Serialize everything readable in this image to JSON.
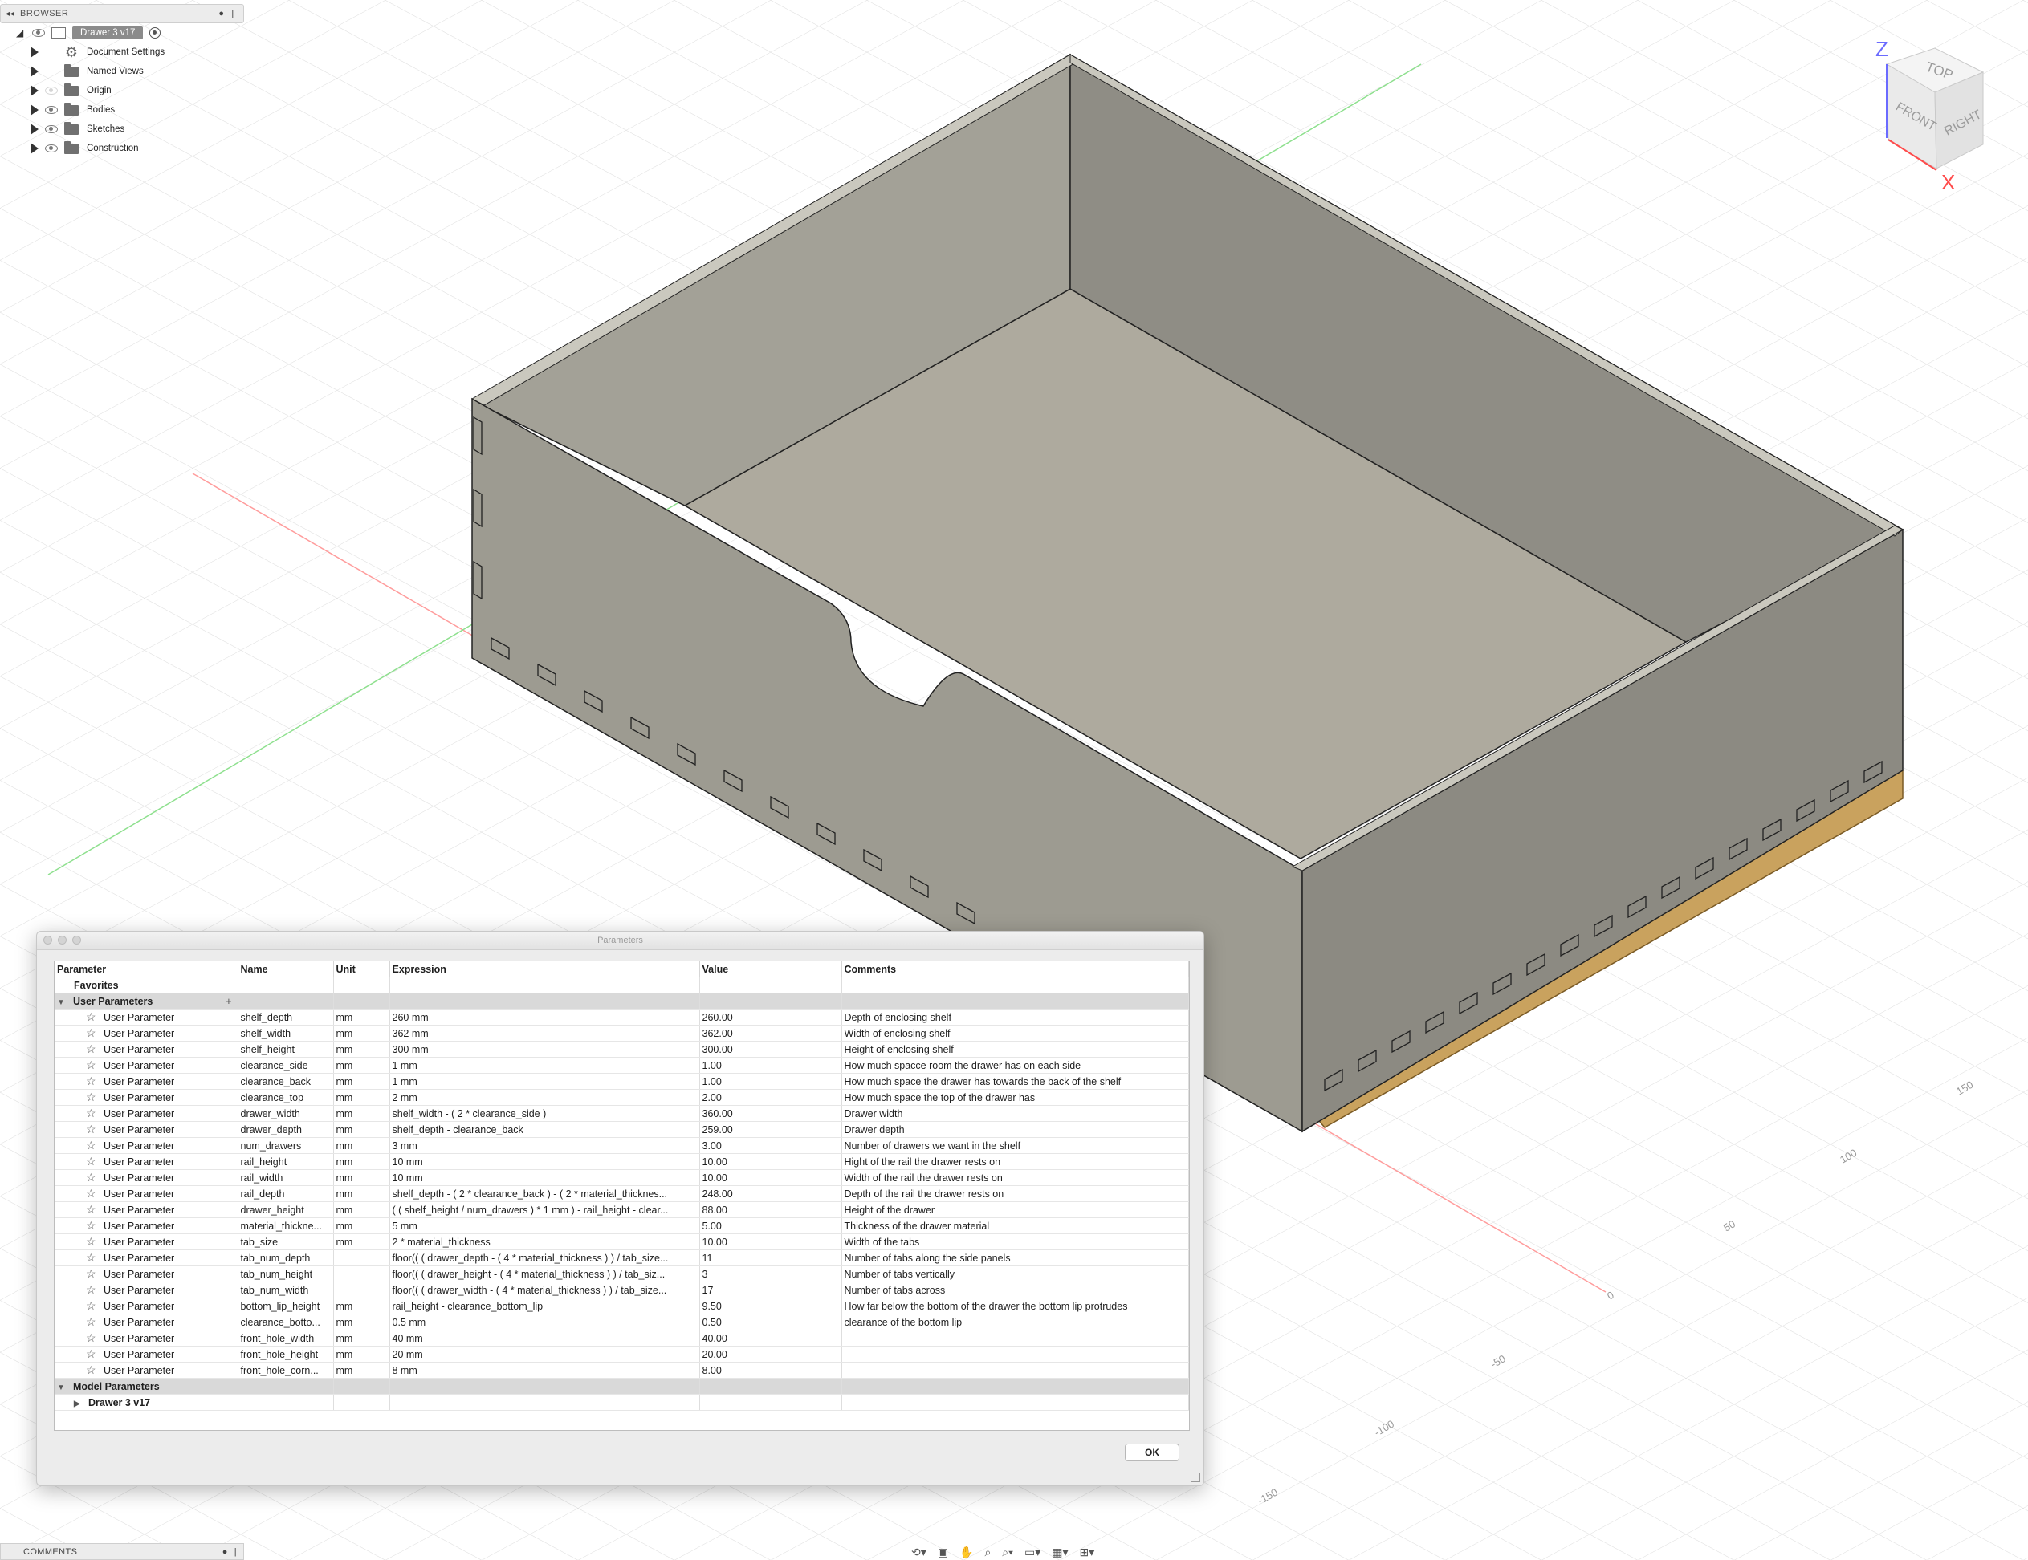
{
  "browser": {
    "title": "BROWSER",
    "collapse_glyph": "◂◂",
    "root_label": "Drawer 3 v17",
    "items": [
      {
        "label": "Document Settings",
        "icon": "gear-icon",
        "visible": null
      },
      {
        "label": "Named Views",
        "icon": "folder-icon",
        "visible": null
      },
      {
        "label": "Origin",
        "icon": "folder-icon",
        "visible": false
      },
      {
        "label": "Bodies",
        "icon": "folder-icon",
        "visible": true
      },
      {
        "label": "Sketches",
        "icon": "folder-icon",
        "visible": true
      },
      {
        "label": "Construction",
        "icon": "folder-icon",
        "visible": true
      }
    ]
  },
  "viewcube": {
    "axis_z": "Z",
    "axis_x": "X",
    "face_top": "TOP",
    "face_front": "FRONT",
    "face_right": "RIGHT",
    "axis_z_color": "#6b6bff",
    "axis_x_color": "#ff4b4b"
  },
  "grid_labels": [
    "150",
    "100",
    "50",
    "0",
    "-50",
    "-100",
    "-150"
  ],
  "dialog": {
    "title": "Parameters",
    "columns": [
      "Parameter",
      "Name",
      "Unit",
      "Expression",
      "Value",
      "Comments"
    ],
    "favorites_label": "Favorites",
    "user_group_label": "User Parameters",
    "model_group_label": "Model Parameters",
    "model_child_label": "Drawer 3 v17",
    "ok_label": "OK",
    "rows": [
      {
        "type": "User Parameter",
        "name": "shelf_depth",
        "unit": "mm",
        "expr": "260 mm",
        "value": "260.00",
        "comment": "Depth of enclosing shelf"
      },
      {
        "type": "User Parameter",
        "name": "shelf_width",
        "unit": "mm",
        "expr": "362 mm",
        "value": "362.00",
        "comment": "Width of enclosing shelf"
      },
      {
        "type": "User Parameter",
        "name": "shelf_height",
        "unit": "mm",
        "expr": "300 mm",
        "value": "300.00",
        "comment": "Height of enclosing shelf"
      },
      {
        "type": "User Parameter",
        "name": "clearance_side",
        "unit": "mm",
        "expr": "1 mm",
        "value": "1.00",
        "comment": "How much spacce room the drawer has on each side"
      },
      {
        "type": "User Parameter",
        "name": "clearance_back",
        "unit": "mm",
        "expr": "1 mm",
        "value": "1.00",
        "comment": "How much space the drawer has towards the back of the shelf"
      },
      {
        "type": "User Parameter",
        "name": "clearance_top",
        "unit": "mm",
        "expr": "2 mm",
        "value": "2.00",
        "comment": "How much space the top of the drawer has"
      },
      {
        "type": "User Parameter",
        "name": "drawer_width",
        "unit": "mm",
        "expr": "shelf_width - ( 2 * clearance_side )",
        "value": "360.00",
        "comment": "Drawer width"
      },
      {
        "type": "User Parameter",
        "name": "drawer_depth",
        "unit": "mm",
        "expr": "shelf_depth - clearance_back",
        "value": "259.00",
        "comment": "Drawer depth"
      },
      {
        "type": "User Parameter",
        "name": "num_drawers",
        "unit": "mm",
        "expr": "3 mm",
        "value": "3.00",
        "comment": "Number of drawers we want in the shelf"
      },
      {
        "type": "User Parameter",
        "name": "rail_height",
        "unit": "mm",
        "expr": "10 mm",
        "value": "10.00",
        "comment": "Hight of the rail the drawer rests on"
      },
      {
        "type": "User Parameter",
        "name": "rail_width",
        "unit": "mm",
        "expr": "10 mm",
        "value": "10.00",
        "comment": "Width of the rail the drawer rests on"
      },
      {
        "type": "User Parameter",
        "name": "rail_depth",
        "unit": "mm",
        "expr": "shelf_depth - ( 2 * clearance_back ) - ( 2 * material_thicknes...",
        "value": "248.00",
        "comment": "Depth of the rail the drawer rests on"
      },
      {
        "type": "User Parameter",
        "name": "drawer_height",
        "unit": "mm",
        "expr": "( ( shelf_height / num_drawers ) * 1 mm ) - rail_height - clear...",
        "value": "88.00",
        "comment": "Height of the drawer"
      },
      {
        "type": "User Parameter",
        "name": "material_thickne...",
        "unit": "mm",
        "expr": "5 mm",
        "value": "5.00",
        "comment": "Thickness of the drawer material"
      },
      {
        "type": "User Parameter",
        "name": "tab_size",
        "unit": "mm",
        "expr": "2 * material_thickness",
        "value": "10.00",
        "comment": "Width of the tabs"
      },
      {
        "type": "User Parameter",
        "name": "tab_num_depth",
        "unit": "",
        "expr": "floor(( ( drawer_depth - ( 4 * material_thickness ) ) / tab_size...",
        "value": "11",
        "comment": "Number of tabs along the side panels"
      },
      {
        "type": "User Parameter",
        "name": "tab_num_height",
        "unit": "",
        "expr": "floor(( ( drawer_height - ( 4 * material_thickness ) ) / tab_siz...",
        "value": "3",
        "comment": "Number of tabs vertically"
      },
      {
        "type": "User Parameter",
        "name": "tab_num_width",
        "unit": "",
        "expr": "floor(( ( drawer_width - ( 4 * material_thickness ) ) / tab_size...",
        "value": "17",
        "comment": "Number of tabs across"
      },
      {
        "type": "User Parameter",
        "name": "bottom_lip_height",
        "unit": "mm",
        "expr": "rail_height - clearance_bottom_lip",
        "value": "9.50",
        "comment": "How far below the bottom of the drawer the bottom lip protrudes"
      },
      {
        "type": "User Parameter",
        "name": "clearance_botto...",
        "unit": "mm",
        "expr": "0.5 mm",
        "value": "0.50",
        "comment": "clearance of the bottom lip"
      },
      {
        "type": "User Parameter",
        "name": "front_hole_width",
        "unit": "mm",
        "expr": "40 mm",
        "value": "40.00",
        "comment": ""
      },
      {
        "type": "User Parameter",
        "name": "front_hole_height",
        "unit": "mm",
        "expr": "20 mm",
        "value": "20.00",
        "comment": ""
      },
      {
        "type": "User Parameter",
        "name": "front_hole_corn...",
        "unit": "mm",
        "expr": "8 mm",
        "value": "8.00",
        "comment": ""
      }
    ]
  },
  "comments": {
    "title": "COMMENTS"
  },
  "navbar": {
    "items": [
      "orbit-icon",
      "look-at-icon",
      "pan-icon",
      "zoom-icon",
      "fit-icon",
      "display-settings-icon",
      "grid-icon",
      "viewports-icon"
    ]
  }
}
